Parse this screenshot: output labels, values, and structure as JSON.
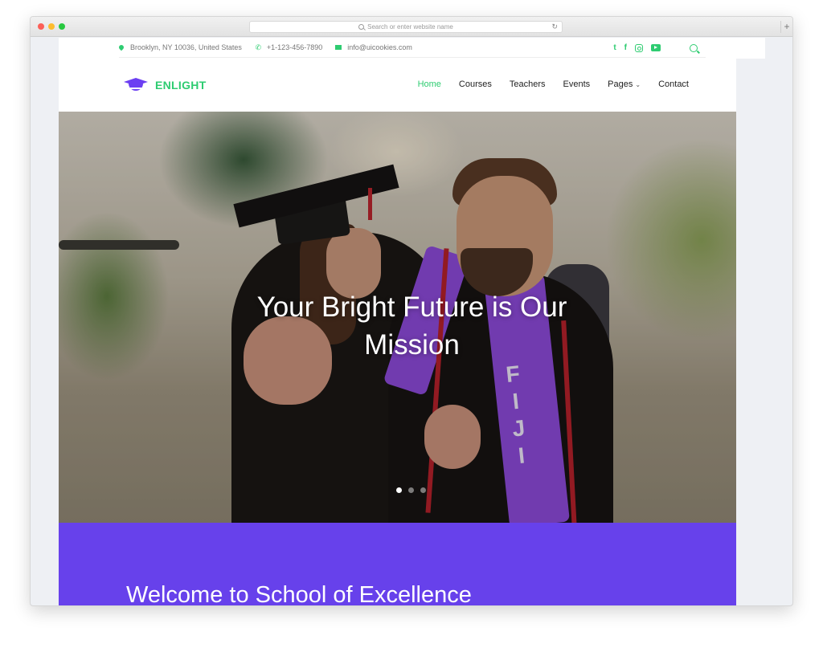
{
  "browser": {
    "url_placeholder": "Search or enter website name",
    "reload_icon": "↻",
    "new_tab_icon": "+"
  },
  "topbar": {
    "address": "Brooklyn, NY 10036, United States",
    "phone": "+1-123-456-7890",
    "email": "info@uicookies.com",
    "phone_icon": "✆",
    "social_twitter": "t",
    "social_facebook": "f"
  },
  "brand": {
    "name": "ENLIGHT",
    "accent": "#2ecc71",
    "primary": "#6741eb"
  },
  "nav": {
    "items": [
      {
        "label": "Home",
        "active": true
      },
      {
        "label": "Courses",
        "active": false
      },
      {
        "label": "Teachers",
        "active": false
      },
      {
        "label": "Events",
        "active": false
      },
      {
        "label": "Pages",
        "active": false,
        "chevron": "⌄"
      },
      {
        "label": "Contact",
        "active": false
      }
    ]
  },
  "hero": {
    "title_line1": "Your Bright Future is Our",
    "title_line2": "Mission",
    "stole_text": "FIJI",
    "slides": 3,
    "active_slide": 1
  },
  "welcome": {
    "heading": "Welcome to School of Excellence"
  }
}
